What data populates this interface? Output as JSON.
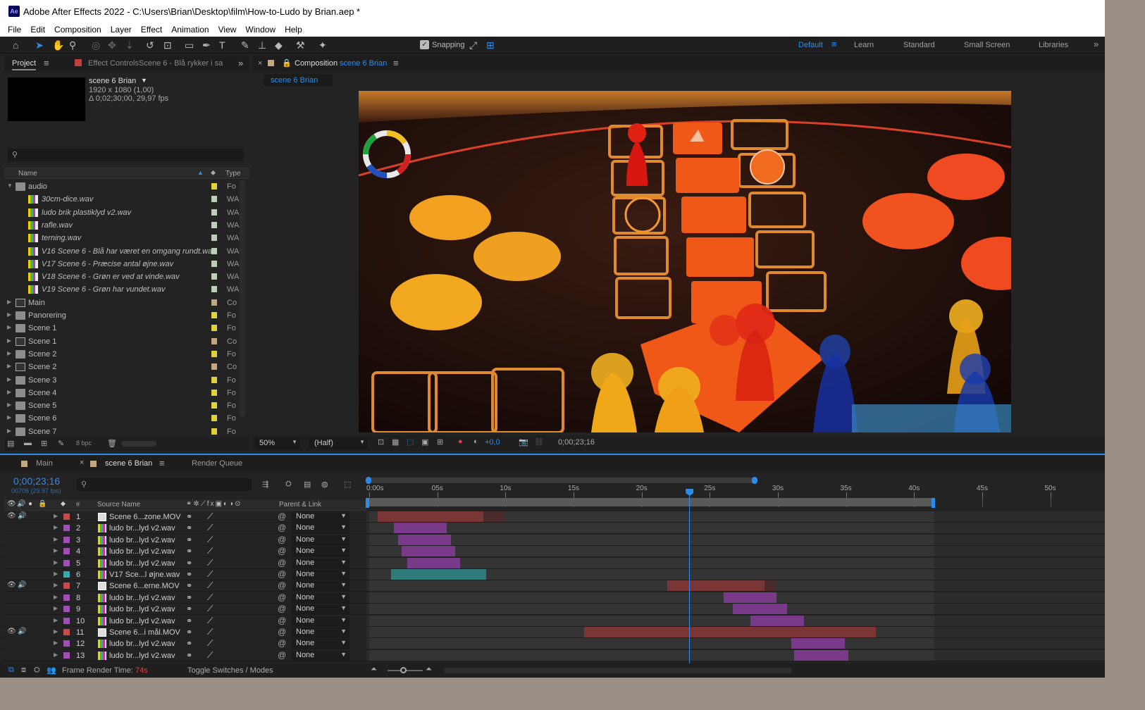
{
  "window": {
    "title": "Adobe After Effects 2022 - C:\\Users\\Brian\\Desktop\\film\\How-to-Ludo by Brian.aep *",
    "logo": "Ae"
  },
  "menu": [
    "File",
    "Edit",
    "Composition",
    "Layer",
    "Effect",
    "Animation",
    "View",
    "Window",
    "Help"
  ],
  "toolbar": {
    "snapping_label": "Snapping",
    "workspaces": [
      "Default",
      "Learn",
      "Standard",
      "Small Screen",
      "Libraries"
    ]
  },
  "project": {
    "tab_label": "Project",
    "effect_controls_label": "Effect Controls",
    "effect_controls_target": "Scene 6 - Blå rykker i sa",
    "comp_name": "scene 6 Brian",
    "comp_res": "1920 x 1080 (1,00)",
    "comp_dur": "Δ 0;02;30;00, 29,97 fps",
    "col_name": "Name",
    "col_type": "Type",
    "bpc": "8 bpc",
    "items": [
      {
        "name": "audio",
        "type": "Fo",
        "kind": "folder",
        "indent": 0,
        "label": "#e0d23a",
        "open": true
      },
      {
        "name": "30cm-dice.wav",
        "type": "WA",
        "kind": "audio",
        "indent": 1,
        "label": "#b9d0b4"
      },
      {
        "name": "ludo brik plastiklyd v2.wav",
        "type": "WA",
        "kind": "audio",
        "indent": 1,
        "label": "#b9d0b4"
      },
      {
        "name": "rafle.wav",
        "type": "WA",
        "kind": "audio",
        "indent": 1,
        "label": "#b9d0b4"
      },
      {
        "name": "terning.wav",
        "type": "WA",
        "kind": "audio",
        "indent": 1,
        "label": "#b9d0b4"
      },
      {
        "name": "V16 Scene 6 - Blå har været en omgang rundt.wav",
        "type": "WA",
        "kind": "audio",
        "indent": 1,
        "label": "#b9d0b4"
      },
      {
        "name": "V17 Scene 6 - Præcise antal øjne.wav",
        "type": "WA",
        "kind": "audio",
        "indent": 1,
        "label": "#b9d0b4"
      },
      {
        "name": "V18 Scene 6 - Grøn er ved at vinde.wav",
        "type": "WA",
        "kind": "audio",
        "indent": 1,
        "label": "#b9d0b4"
      },
      {
        "name": "V19 Scene 6 - Grøn har vundet.wav",
        "type": "WA",
        "kind": "audio",
        "indent": 1,
        "label": "#b9d0b4"
      },
      {
        "name": "Main",
        "type": "Co",
        "kind": "comp",
        "indent": 0,
        "label": "#c4a882"
      },
      {
        "name": "Panorering",
        "type": "Fo",
        "kind": "folder",
        "indent": 0,
        "label": "#e0d23a"
      },
      {
        "name": "Scene 1",
        "type": "Fo",
        "kind": "folder",
        "indent": 0,
        "label": "#e0d23a"
      },
      {
        "name": "Scene 1",
        "type": "Co",
        "kind": "comp",
        "indent": 0,
        "label": "#c4a882"
      },
      {
        "name": "Scene 2",
        "type": "Fo",
        "kind": "folder",
        "indent": 0,
        "label": "#e0d23a"
      },
      {
        "name": "Scene 2",
        "type": "Co",
        "kind": "comp",
        "indent": 0,
        "label": "#c4a882"
      },
      {
        "name": "Scene 3",
        "type": "Fo",
        "kind": "folder",
        "indent": 0,
        "label": "#e0d23a"
      },
      {
        "name": "Scene 4",
        "type": "Fo",
        "kind": "folder",
        "indent": 0,
        "label": "#e0d23a"
      },
      {
        "name": "Scene 5",
        "type": "Fo",
        "kind": "folder",
        "indent": 0,
        "label": "#e0d23a"
      },
      {
        "name": "Scene 6",
        "type": "Fo",
        "kind": "folder",
        "indent": 0,
        "label": "#e0d23a"
      },
      {
        "name": "Scene 7",
        "type": "Fo",
        "kind": "folder",
        "indent": 0,
        "label": "#e0d23a"
      }
    ]
  },
  "composition": {
    "tab_prefix": "Composition",
    "tab_name": "scene 6 Brian",
    "subtab": "scene 6 Brian",
    "zoom": "50%",
    "resolution": "(Half)",
    "exposure": "+0,0",
    "timecode": "0;00;23;16"
  },
  "timeline": {
    "tabs": [
      "Main",
      "scene 6 Brian",
      "Render Queue"
    ],
    "current_time": "0;00;23;16",
    "frames": "00706 (29.97 fps)",
    "col_source": "Source Name",
    "col_parent": "Parent & Link",
    "ruler": [
      "0:00s",
      "05s",
      "10s",
      "15s",
      "20s",
      "25s",
      "30s",
      "35s",
      "40s",
      "45s",
      "50s"
    ],
    "playhead_sec": 23.5,
    "work_area_end_sec": 41.5,
    "layers": [
      {
        "num": "1",
        "name": "Scene 6...zone.MOV",
        "label": "#c84a4a",
        "kind": "video",
        "av": true,
        "parent": "None",
        "start": 0.6,
        "end": 8.4,
        "bar": "#7a3535",
        "ghost_end": 9.9
      },
      {
        "num": "2",
        "name": "ludo br...lyd v2.wav",
        "label": "#a050b0",
        "kind": "audio",
        "av": false,
        "parent": "None",
        "start": 1.8,
        "end": 5.7,
        "bar": "#7a3a8a"
      },
      {
        "num": "3",
        "name": "ludo br...lyd v2.wav",
        "label": "#a050b0",
        "kind": "audio",
        "av": false,
        "parent": "None",
        "start": 2.1,
        "end": 6.0,
        "bar": "#7a3a8a"
      },
      {
        "num": "4",
        "name": "ludo br...lyd v2.wav",
        "label": "#a050b0",
        "kind": "audio",
        "av": false,
        "parent": "None",
        "start": 2.4,
        "end": 6.3,
        "bar": "#7a3a8a"
      },
      {
        "num": "5",
        "name": "ludo br...lyd v2.wav",
        "label": "#a050b0",
        "kind": "audio",
        "av": false,
        "parent": "None",
        "start": 2.8,
        "end": 6.7,
        "bar": "#7a3a8a"
      },
      {
        "num": "6",
        "name": "V17 Sce...l øjne.wav",
        "label": "#3aa8a8",
        "kind": "audio",
        "av": false,
        "parent": "None",
        "start": 1.6,
        "end": 8.6,
        "bar": "#2f7a7a"
      },
      {
        "num": "7",
        "name": "Scene 6...erne.MOV",
        "label": "#c84a4a",
        "kind": "video",
        "av": true,
        "parent": "None",
        "start": 21.9,
        "end": 29.0,
        "bar": "#7a3535",
        "ghost_end": 29.9
      },
      {
        "num": "8",
        "name": "ludo br...lyd v2.wav",
        "label": "#a050b0",
        "kind": "audio",
        "av": false,
        "parent": "None",
        "start": 26.0,
        "end": 29.9,
        "bar": "#7a3a8a"
      },
      {
        "num": "9",
        "name": "ludo br...lyd v2.wav",
        "label": "#a050b0",
        "kind": "audio",
        "av": false,
        "parent": "None",
        "start": 26.7,
        "end": 30.7,
        "bar": "#7a3a8a"
      },
      {
        "num": "10",
        "name": "ludo br...lyd v2.wav",
        "label": "#a050b0",
        "kind": "audio",
        "av": false,
        "parent": "None",
        "start": 28.0,
        "end": 31.9,
        "bar": "#7a3a8a"
      },
      {
        "num": "11",
        "name": "Scene 6...i mål.MOV",
        "label": "#c84a4a",
        "kind": "video",
        "av": true,
        "parent": "None",
        "start": 15.8,
        "end": 37.2,
        "bar": "#7a3535",
        "ghost_end": 29.0
      },
      {
        "num": "12",
        "name": "ludo br...lyd v2.wav",
        "label": "#a050b0",
        "kind": "audio",
        "av": false,
        "parent": "None",
        "start": 31.0,
        "end": 34.9,
        "bar": "#7a3a8a"
      },
      {
        "num": "13",
        "name": "ludo br...lyd v2.wav",
        "label": "#a050b0",
        "kind": "audio",
        "av": false,
        "parent": "None",
        "start": 31.2,
        "end": 35.2,
        "bar": "#7a3a8a"
      }
    ],
    "footer": {
      "render_label": "Frame Render Time:",
      "render_value": "74s",
      "toggle": "Toggle Switches / Modes"
    }
  },
  "colors": {
    "accent": "#2d8ceb",
    "panel": "#232323",
    "playhead": "#2d8ceb"
  }
}
